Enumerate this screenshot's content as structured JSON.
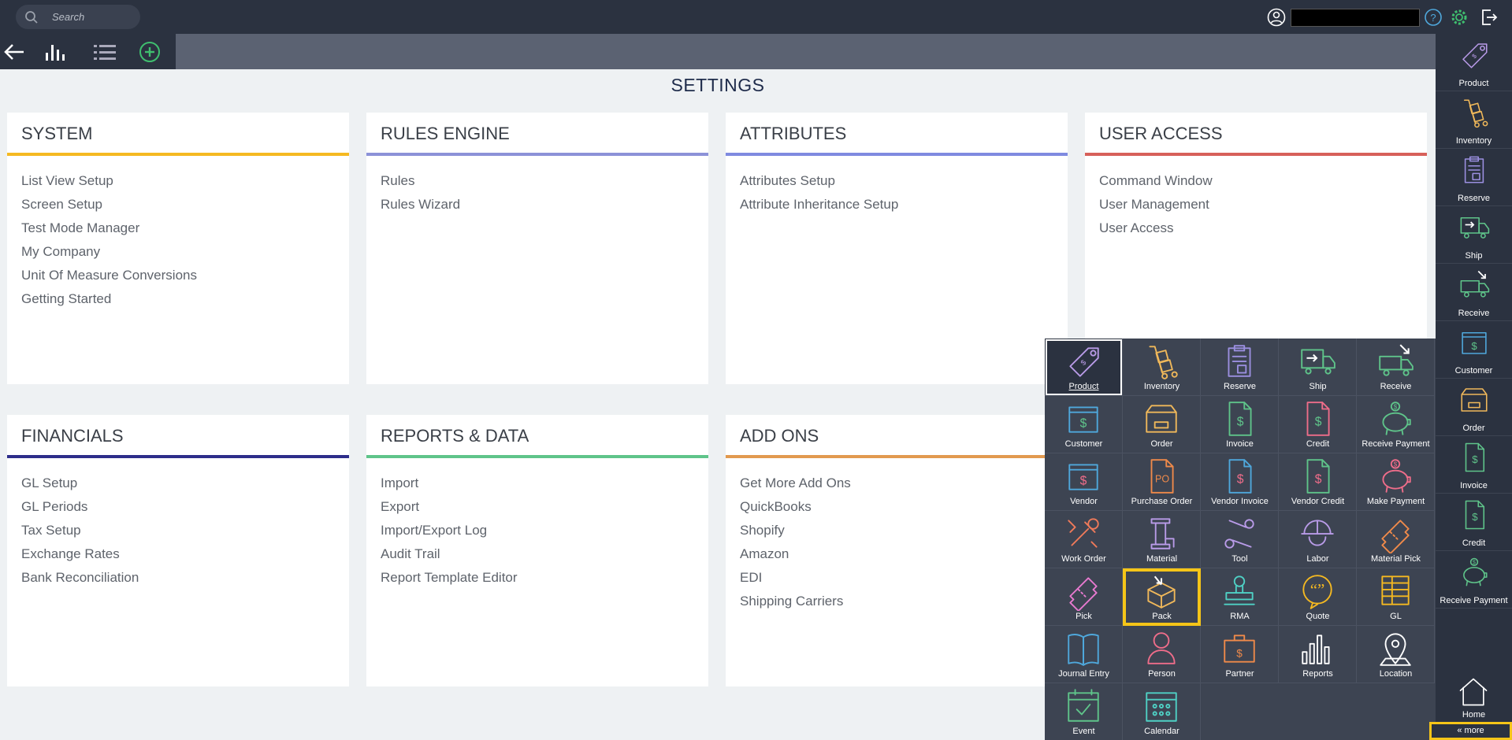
{
  "search": {
    "placeholder": "Search"
  },
  "page_title": "SETTINGS",
  "colors": {
    "system": "#f5b921",
    "rules": "#8c92d8",
    "attributes": "#7f8ae0",
    "user_access": "#d7605a",
    "financials": "#2d2d8a",
    "reports": "#5fc48a",
    "addons": "#e29a4f"
  },
  "cards": {
    "system": {
      "title": "SYSTEM",
      "items": [
        "List View Setup",
        "Screen Setup",
        "Test Mode Manager",
        "My Company",
        "Unit Of Measure Conversions",
        "Getting Started"
      ]
    },
    "rules": {
      "title": "RULES ENGINE",
      "items": [
        "Rules",
        "Rules Wizard"
      ]
    },
    "attributes": {
      "title": "ATTRIBUTES",
      "items": [
        "Attributes Setup",
        "Attribute Inheritance Setup"
      ]
    },
    "user_access": {
      "title": "USER ACCESS",
      "items": [
        "Command Window",
        "User Management",
        "User Access"
      ]
    },
    "financials": {
      "title": "FINANCIALS",
      "items": [
        "GL Setup",
        "GL Periods",
        "Tax Setup",
        "Exchange Rates",
        "Bank Reconciliation"
      ]
    },
    "reports": {
      "title": "REPORTS & DATA",
      "items": [
        "Import",
        "Export",
        "Import/Export Log",
        "Audit Trail",
        "Report Template Editor"
      ]
    },
    "addons": {
      "title": "ADD ONS",
      "items": [
        "Get More Add Ons",
        "QuickBooks",
        "Shopify",
        "Amazon",
        "EDI",
        "Shipping Carriers"
      ]
    }
  },
  "modules": [
    {
      "label": "Product",
      "icon": "tag-icon",
      "color": "#b99be8"
    },
    {
      "label": "Inventory",
      "icon": "hand-truck-icon",
      "color": "#f0b85a"
    },
    {
      "label": "Reserve",
      "icon": "clipboard-icon",
      "color": "#9b8fe0"
    },
    {
      "label": "Ship",
      "icon": "truck-out-icon",
      "color": "#5fc48a"
    },
    {
      "label": "Receive",
      "icon": "truck-in-icon",
      "color": "#5fc48a"
    },
    {
      "label": "Customer",
      "icon": "customer-icon",
      "color": "#4fa8dc"
    },
    {
      "label": "Order",
      "icon": "box-icon",
      "color": "#f0b85a"
    },
    {
      "label": "Invoice",
      "icon": "invoice-icon",
      "color": "#5fc48a"
    },
    {
      "label": "Credit",
      "icon": "credit-icon",
      "color": "#ef6d8a"
    },
    {
      "label": "Receive Payment",
      "icon": "piggy-bank-icon",
      "color": "#5fc48a"
    },
    {
      "label": "Vendor",
      "icon": "vendor-icon",
      "color": "#4fa8dc"
    },
    {
      "label": "Purchase Order",
      "icon": "purchase-order-icon",
      "color": "#f08a4a"
    },
    {
      "label": "Vendor Invoice",
      "icon": "vendor-invoice-icon",
      "color": "#4fa8dc"
    },
    {
      "label": "Vendor Credit",
      "icon": "vendor-credit-icon",
      "color": "#5fc48a"
    },
    {
      "label": "Make Payment",
      "icon": "piggy-bank-icon",
      "color": "#ef6d8a"
    },
    {
      "label": "Work Order",
      "icon": "tools-icon",
      "color": "#ef7a5a"
    },
    {
      "label": "Material",
      "icon": "spool-icon",
      "color": "#b99be8"
    },
    {
      "label": "Tool",
      "icon": "scissors-icon",
      "color": "#b99be8"
    },
    {
      "label": "Labor",
      "icon": "hardhat-icon",
      "color": "#b99be8"
    },
    {
      "label": "Material Pick",
      "icon": "ticket-icon",
      "color": "#f08a4a"
    },
    {
      "label": "Pick",
      "icon": "ticket-icon",
      "color": "#e87ad0"
    },
    {
      "label": "Pack",
      "icon": "pack-box-icon",
      "color": "#f0b85a"
    },
    {
      "label": "RMA",
      "icon": "stamp-icon",
      "color": "#4fd1c5"
    },
    {
      "label": "Quote",
      "icon": "quote-bubble-icon",
      "color": "#f5b921"
    },
    {
      "label": "GL",
      "icon": "ledger-icon",
      "color": "#f5b921"
    },
    {
      "label": "Journal Entry",
      "icon": "book-icon",
      "color": "#4fa8dc"
    },
    {
      "label": "Person",
      "icon": "person-icon",
      "color": "#ef6d8a"
    },
    {
      "label": "Partner",
      "icon": "briefcase-icon",
      "color": "#f08a4a"
    },
    {
      "label": "Reports",
      "icon": "bar-chart-icon",
      "color": "#ffffff"
    },
    {
      "label": "Location",
      "icon": "map-pin-icon",
      "color": "#ffffff"
    },
    {
      "label": "Event",
      "icon": "event-calendar-icon",
      "color": "#5fc48a"
    },
    {
      "label": "Calendar",
      "icon": "calendar-icon",
      "color": "#4fd1c5"
    }
  ],
  "sidebar": [
    {
      "label": "Product",
      "icon": "tag-icon",
      "color": "#b99be8"
    },
    {
      "label": "Inventory",
      "icon": "hand-truck-icon",
      "color": "#f0b85a"
    },
    {
      "label": "Reserve",
      "icon": "clipboard-icon",
      "color": "#9b8fe0"
    },
    {
      "label": "Ship",
      "icon": "truck-out-icon",
      "color": "#5fc48a"
    },
    {
      "label": "Receive",
      "icon": "truck-in-icon",
      "color": "#5fc48a"
    },
    {
      "label": "Customer",
      "icon": "customer-icon",
      "color": "#4fa8dc"
    },
    {
      "label": "Order",
      "icon": "box-icon",
      "color": "#f0b85a"
    },
    {
      "label": "Invoice",
      "icon": "invoice-icon",
      "color": "#5fc48a"
    },
    {
      "label": "Credit",
      "icon": "credit-icon",
      "color": "#5fc48a"
    },
    {
      "label": "Receive Payment",
      "icon": "piggy-bank-icon",
      "color": "#5fc48a"
    }
  ],
  "home_label": "Home",
  "more_label": "« more"
}
